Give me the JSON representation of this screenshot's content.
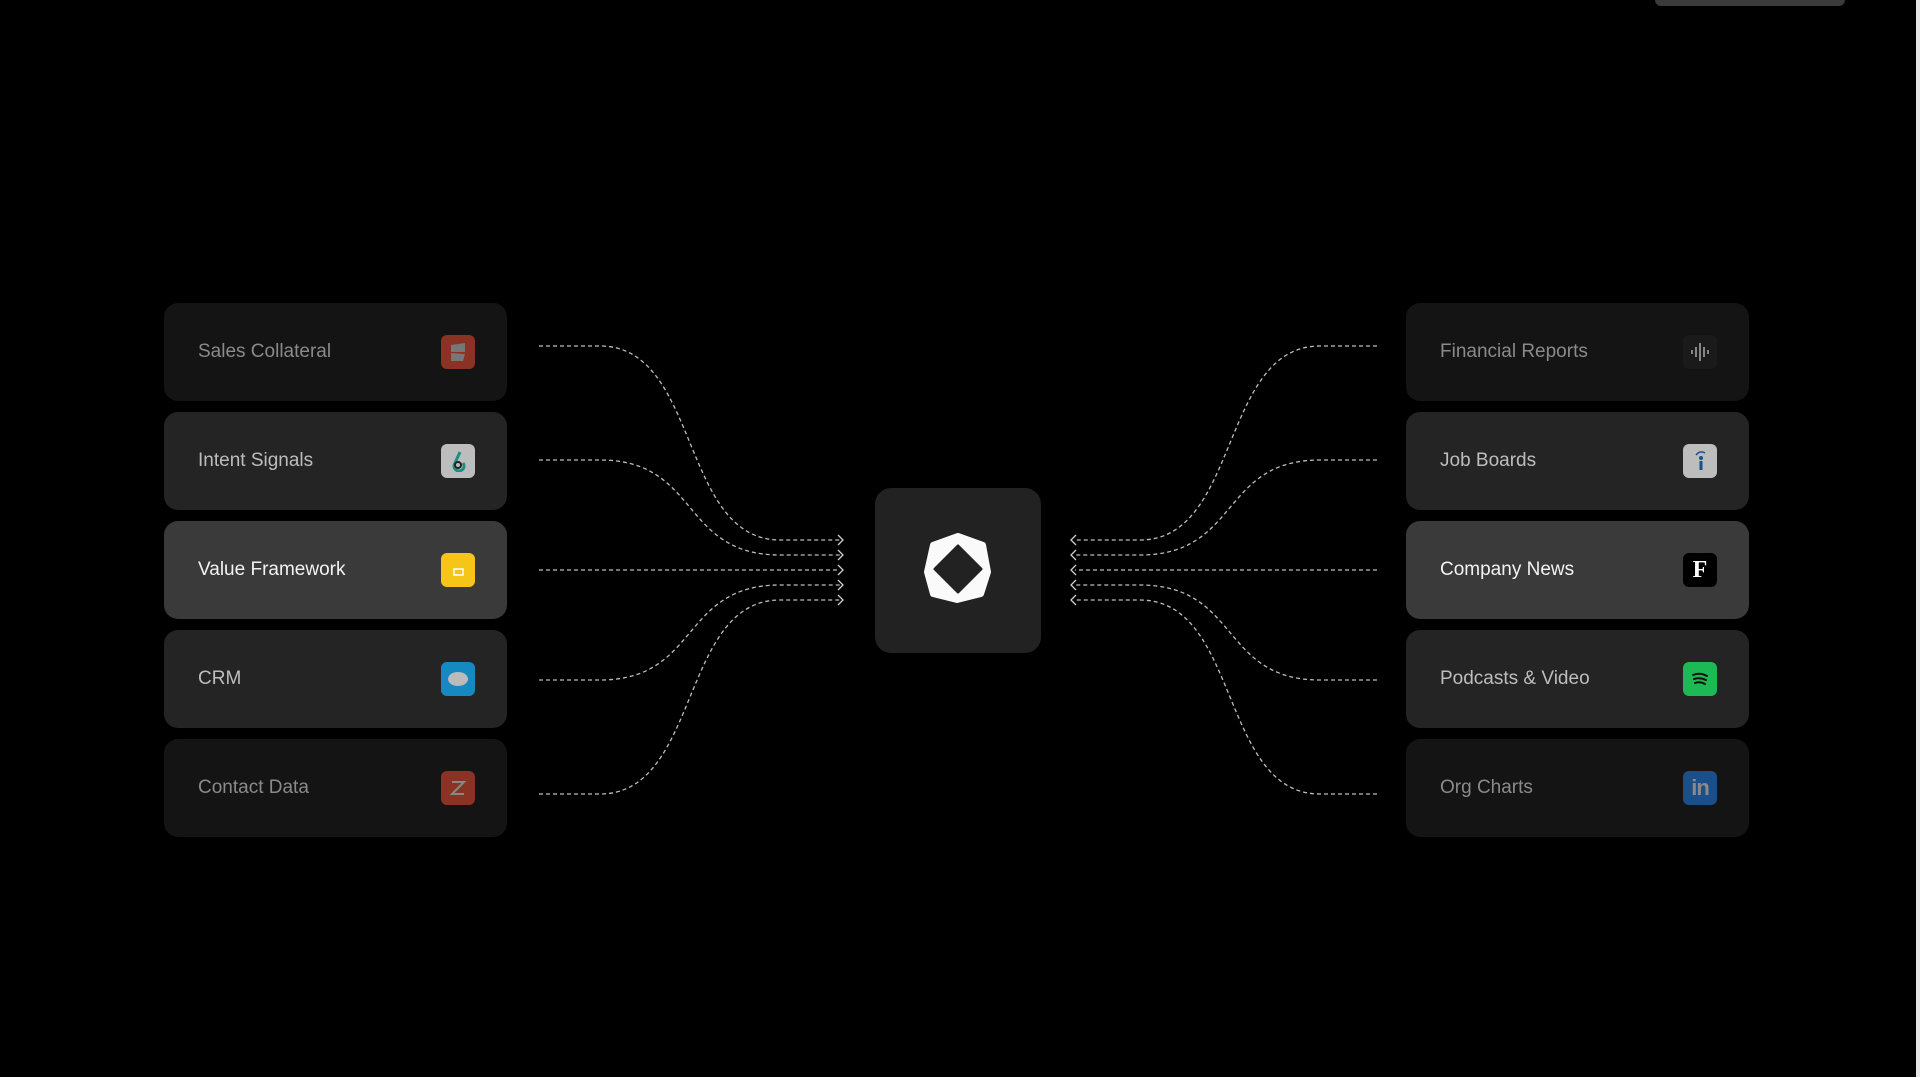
{
  "left_sources": [
    {
      "label": "Sales Collateral",
      "icon": "highspot-icon",
      "icon_color": "#8a3324",
      "tone": 0
    },
    {
      "label": "Intent Signals",
      "icon": "intent-drop-icon",
      "icon_color": "#bdbdbd",
      "tone": 1
    },
    {
      "label": "Value Framework",
      "icon": "google-slides-icon",
      "icon_color": "#f5c518",
      "tone": 2
    },
    {
      "label": "CRM",
      "icon": "salesforce-cloud-icon",
      "icon_color": "#168ac0",
      "tone": 1
    },
    {
      "label": "Contact Data",
      "icon": "zoominfo-icon",
      "icon_color": "#8a3324",
      "tone": 0
    }
  ],
  "right_sources": [
    {
      "label": "Financial Reports",
      "icon": "audio-waveform-icon",
      "icon_color": "#1a1a1a",
      "tone": 0
    },
    {
      "label": "Job Boards",
      "icon": "indeed-icon",
      "icon_color": "#bdbdbd",
      "tone": 1
    },
    {
      "label": "Company News",
      "icon": "forbes-f-icon",
      "icon_color": "#000000",
      "tone": 2
    },
    {
      "label": "Podcasts & Video",
      "icon": "spotify-icon",
      "icon_color": "#1db954",
      "tone": 1
    },
    {
      "label": "Org Charts",
      "icon": "linkedin-icon",
      "icon_color": "#1a4f8a",
      "tone": 0
    }
  ],
  "hub": {
    "icon": "hub-logo-icon"
  }
}
